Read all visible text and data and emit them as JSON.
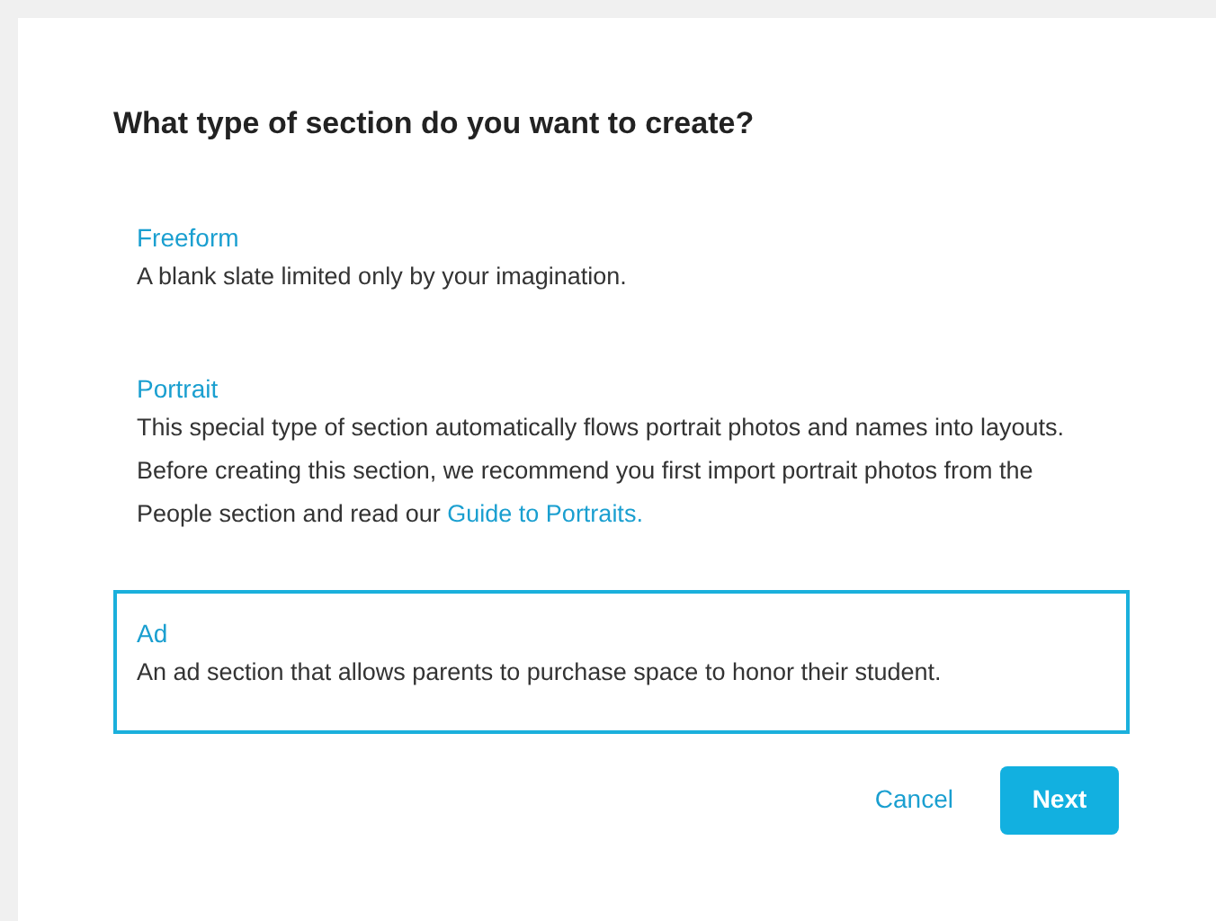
{
  "dialog": {
    "title": "What type of section do you want to create?",
    "options": [
      {
        "label": "Freeform",
        "description": "A blank slate limited only by your imagination.",
        "selected": false
      },
      {
        "label": "Portrait",
        "description": "This special type of section automatically flows portrait photos and names into layouts. Before creating this section, we recommend you first import portrait photos from the People section and read our",
        "link": "Guide to Portraits.",
        "selected": false
      },
      {
        "label": "Ad",
        "description": "An ad section that allows parents to purchase space to honor their student.",
        "selected": true
      }
    ],
    "buttons": {
      "cancel": "Cancel",
      "next": "Next"
    }
  }
}
